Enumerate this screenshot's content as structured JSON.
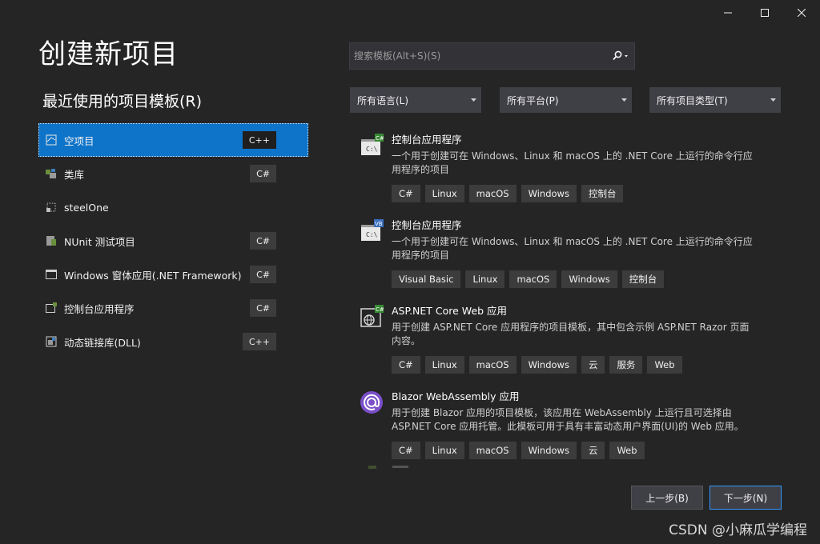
{
  "window": {
    "controls": {
      "minimize": "—",
      "maximize": "☐",
      "close": "✕"
    }
  },
  "page_title": "创建新项目",
  "recent": {
    "title": "最近使用的项目模板(R)",
    "items": [
      {
        "label": "空项目",
        "badge": "C++",
        "icon": "empty-project-icon",
        "selected": true
      },
      {
        "label": "类库",
        "badge": "C#",
        "icon": "class-library-icon"
      },
      {
        "label": "steelOne",
        "badge": "",
        "icon": "steelone-project-icon"
      },
      {
        "label": "NUnit 测试项目",
        "badge": "C#",
        "icon": "nunit-test-icon"
      },
      {
        "label": "Windows 窗体应用(.NET Framework)",
        "badge": "C#",
        "icon": "windows-forms-icon"
      },
      {
        "label": "控制台应用程序",
        "badge": "C#",
        "icon": "console-app-icon"
      },
      {
        "label": "动态链接库(DLL)",
        "badge": "C++",
        "icon": "dll-icon"
      }
    ]
  },
  "search": {
    "placeholder": "搜索模板(Alt+S)(S)"
  },
  "filters": {
    "language": "所有语言(L)",
    "platform": "所有平台(P)",
    "project_type": "所有项目类型(T)"
  },
  "templates": [
    {
      "name": "控制台应用程序",
      "description": "一个用于创建可在 Windows、Linux 和 macOS 上的 .NET Core 上运行的命令行应用程序的项目",
      "tags": [
        "C#",
        "Linux",
        "macOS",
        "Windows",
        "控制台"
      ],
      "icon": "console-csharp-icon",
      "badge": "C#"
    },
    {
      "name": "控制台应用程序",
      "description": "一个用于创建可在 Windows、Linux 和 macOS 上的 .NET Core 上运行的命令行应用程序的项目",
      "tags": [
        "Visual Basic",
        "Linux",
        "macOS",
        "Windows",
        "控制台"
      ],
      "icon": "console-vb-icon",
      "badge": "VB"
    },
    {
      "name": "ASP.NET Core Web 应用",
      "description": "用于创建 ASP.NET Core 应用程序的项目模板，其中包含示例 ASP.NET Razor 页面内容。",
      "tags": [
        "C#",
        "Linux",
        "macOS",
        "Windows",
        "云",
        "服务",
        "Web"
      ],
      "icon": "aspnet-web-icon",
      "badge": "C#"
    },
    {
      "name": "Blazor WebAssembly 应用",
      "description": "用于创建 Blazor 应用的项目模板，该应用在 WebAssembly 上运行且可选择由 ASP.NET Core 应用托管。此模板可用于具有丰富动态用户界面(UI)的 Web 应用。",
      "tags": [
        "C#",
        "Linux",
        "macOS",
        "Windows",
        "云",
        "Web"
      ],
      "icon": "blazor-icon",
      "badge": ""
    }
  ],
  "buttons": {
    "back": "上一步(B)",
    "next": "下一步(N)"
  },
  "watermark": "CSDN @小麻瓜学编程",
  "colors": {
    "background": "#252526",
    "accent": "#0e74c9",
    "tag_bg": "#3c3c3c",
    "primary_border": "#3399ff",
    "blazor_purple": "#7b4fc9"
  }
}
